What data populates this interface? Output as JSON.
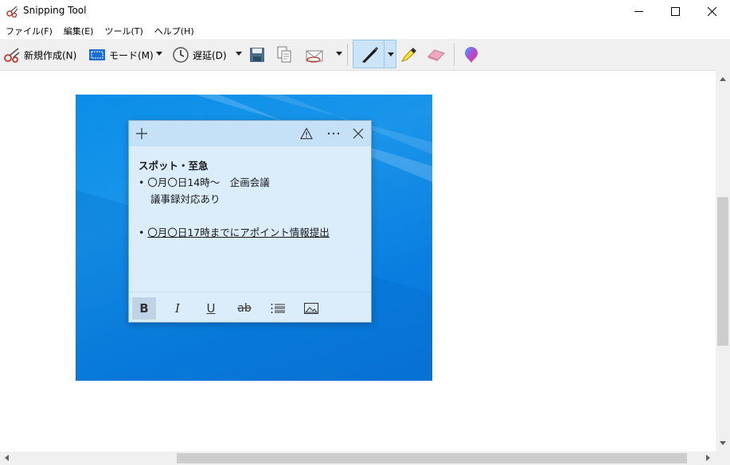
{
  "window": {
    "title": "Snipping Tool"
  },
  "menu": {
    "file": "ファイル(F)",
    "edit": "編集(E)",
    "tools": "ツール(T)",
    "help": "ヘルプ(H)"
  },
  "toolbar": {
    "new_label": "新規作成(N)",
    "mode_label": "モード(M)",
    "delay_label": "遅延(D)"
  },
  "note": {
    "heading": "スポット・至急",
    "bullet1": "• 〇月〇日14時～　企画会議",
    "bullet1_cont": "議事録対応あり",
    "bullet2_mark": "• ",
    "bullet2": "〇月〇日17時までにアポイント情報提出",
    "format_buttons": [
      "B",
      "I",
      "U",
      "ab"
    ]
  },
  "colors": {
    "accent": "#0078d7",
    "note_bg": "#dbecfb",
    "note_header": "#c5e1f8",
    "toolbar_bg": "#f0f0f0"
  }
}
